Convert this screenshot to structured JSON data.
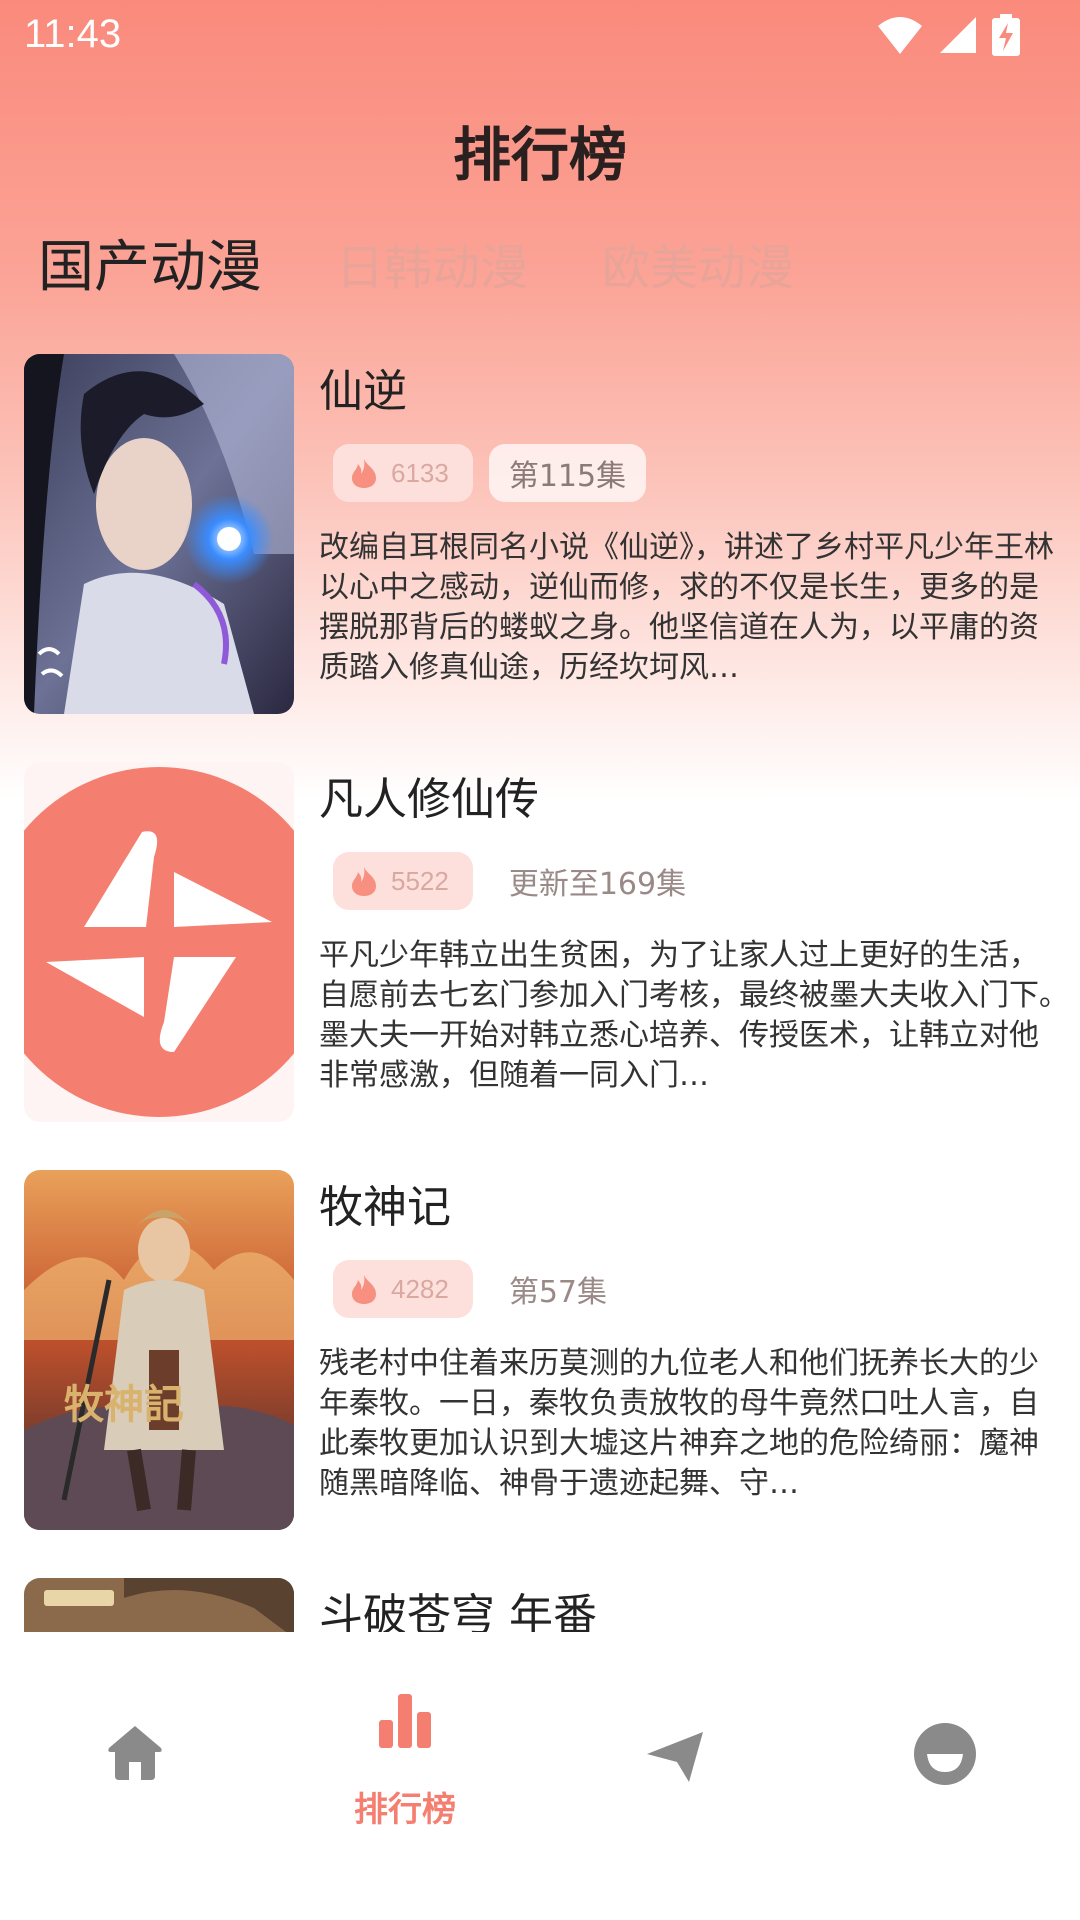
{
  "status": {
    "time": "11:43"
  },
  "header": {
    "title": "排行榜"
  },
  "tabs": [
    "国产动漫",
    "日韩动漫",
    "欧美动漫"
  ],
  "items": [
    {
      "title": "仙逆",
      "hot": "6133",
      "episode": "第115集",
      "desc": "改编自耳根同名小说《仙逆》，讲述了乡村平凡少年王林以心中之感动，逆仙而修，求的不仅是长生，更多的是摆脱那背后的蝼蚁之身。他坚信道在人为，以平庸的资质踏入修真仙途，历经坎坷风…"
    },
    {
      "title": "凡人修仙传",
      "hot": "5522",
      "episode": "更新至169集",
      "desc": "平凡少年韩立出生贫困，为了让家人过上更好的生活，自愿前去七玄门参加入门考核，最终被墨大夫收入门下。　　墨大夫一开始对韩立悉心培养、传授医术，让韩立对他非常感激，但随着一同入门…"
    },
    {
      "title": "牧神记",
      "hot": "4282",
      "episode": "第57集",
      "desc": "残老村中住着来历莫测的九位老人和他们抚养长大的少年秦牧。一日，秦牧负责放牧的母牛竟然口吐人言，自此秦牧更加认识到大墟这片神弃之地的危险绮丽：魔神随黑暗降临、神骨于遗迹起舞、守…"
    },
    {
      "title": "斗破苍穹 年番"
    }
  ],
  "nav": {
    "rank_label": "排行榜"
  },
  "colors": {
    "accent": "#f47f70",
    "header_top": "#fa8a7c",
    "tab_inactive": "#e9a49a",
    "nav_inactive": "#8a8a8a"
  },
  "icons": {
    "home": "home-icon",
    "rank": "bar-chart-icon",
    "discover": "paper-plane-icon",
    "profile": "profile-icon"
  }
}
